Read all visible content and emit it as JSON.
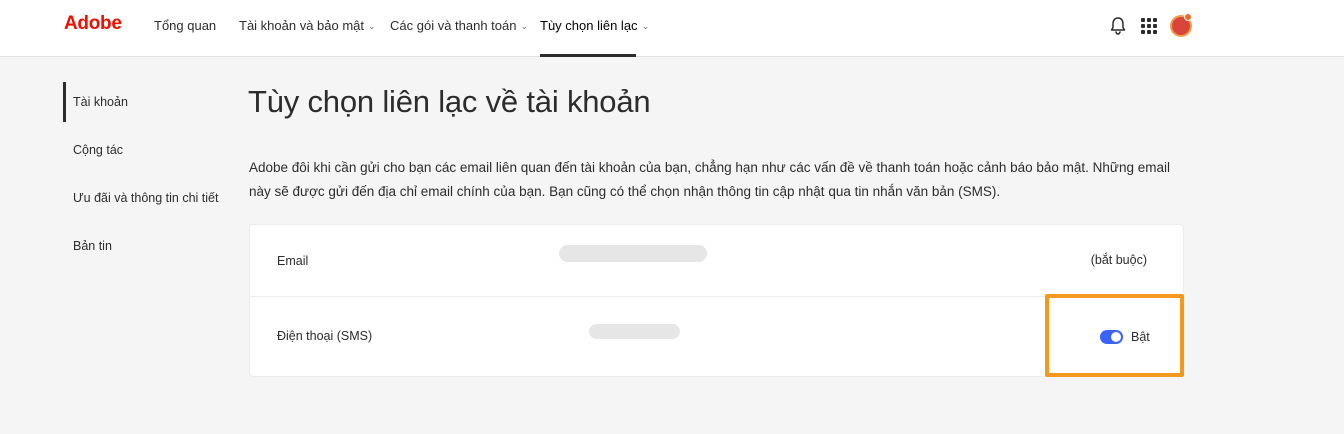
{
  "header": {
    "logo": "Adobe",
    "nav": [
      {
        "label": "Tổng quan",
        "has_dropdown": false
      },
      {
        "label": "Tài khoản và bảo mật",
        "has_dropdown": true
      },
      {
        "label": "Các gói và thanh toán",
        "has_dropdown": true
      },
      {
        "label": "Tùy chọn liên lạc",
        "has_dropdown": true,
        "active": true
      }
    ],
    "icons": [
      "bell-icon",
      "apps-grid-icon",
      "avatar"
    ]
  },
  "sidebar": {
    "items": [
      {
        "label": "Tài khoản",
        "active": true
      },
      {
        "label": "Cộng tác"
      },
      {
        "label": "Ưu đãi và thông tin chi tiết"
      },
      {
        "label": "Bản tin"
      }
    ]
  },
  "main": {
    "title": "Tùy chọn liên lạc về tài khoản",
    "description": "Adobe đôi khi cần gửi cho bạn các email liên quan đến tài khoản của bạn, chẳng hạn như các vấn đề về thanh toán hoặc cảnh báo bảo mật. Những email này sẽ được gửi đến địa chỉ email chính của bạn. Bạn cũng có thể chọn nhận thông tin cập nhật qua tin nhắn văn bản (SMS).",
    "rows": [
      {
        "label": "Email",
        "status": "(bắt buộc)"
      },
      {
        "label": "Điện thoại (SMS)",
        "toggle_label": "Bật",
        "toggle_on": true
      }
    ]
  },
  "colors": {
    "brand": "#eb1000",
    "toggle_on": "#3b63fb",
    "highlight": "#f39a1e"
  }
}
